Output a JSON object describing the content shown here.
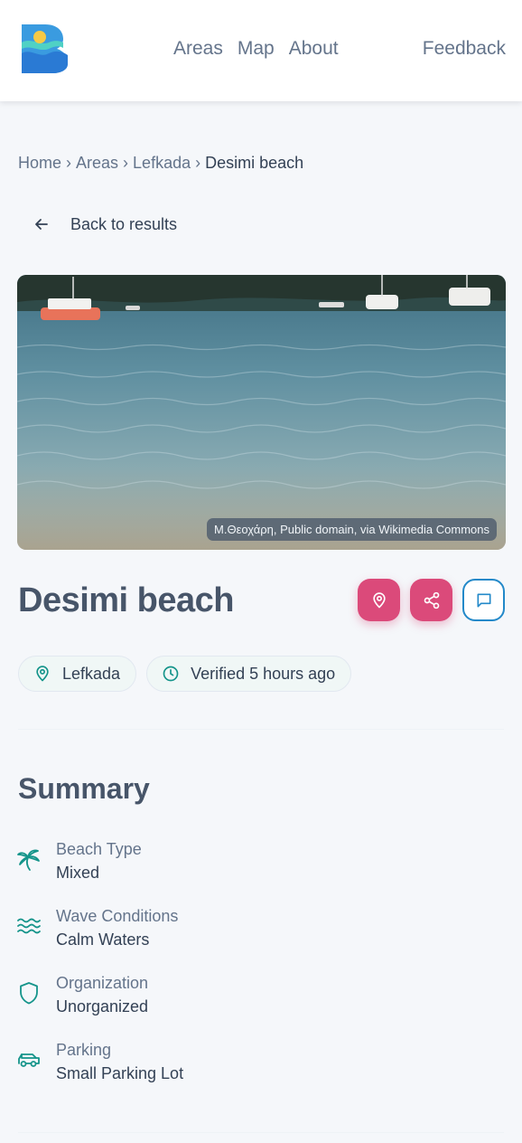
{
  "brand": {
    "logo_letter": "B"
  },
  "nav": {
    "items": [
      "Areas",
      "Map",
      "About"
    ],
    "feedback": "Feedback"
  },
  "breadcrumb": {
    "items": [
      "Home",
      "Areas",
      "Lefkada"
    ],
    "current": "Desimi beach",
    "separator": "›"
  },
  "back_label": "Back to results",
  "photo": {
    "credit": "Μ.Θεοχάρη, Public domain, via Wikimedia Commons"
  },
  "beach": {
    "name": "Desimi beach",
    "area_chip": "Lefkada",
    "verified_chip": "Verified 5 hours ago"
  },
  "icons": {
    "location_action": "map-pin-icon",
    "share_action": "share-icon",
    "comment_action": "message-icon"
  },
  "colors": {
    "accent_pink": "#db4a7a",
    "accent_blue": "#2389c9",
    "teal_icon": "#14948a"
  },
  "summary": {
    "title": "Summary",
    "features": [
      {
        "icon": "palm-tree-icon",
        "label": "Beach Type",
        "value": "Mixed"
      },
      {
        "icon": "waves-icon",
        "label": "Wave Conditions",
        "value": "Calm Waters"
      },
      {
        "icon": "shield-icon",
        "label": "Organization",
        "value": "Unorganized"
      },
      {
        "icon": "car-icon",
        "label": "Parking",
        "value": "Small Parking Lot"
      }
    ]
  }
}
